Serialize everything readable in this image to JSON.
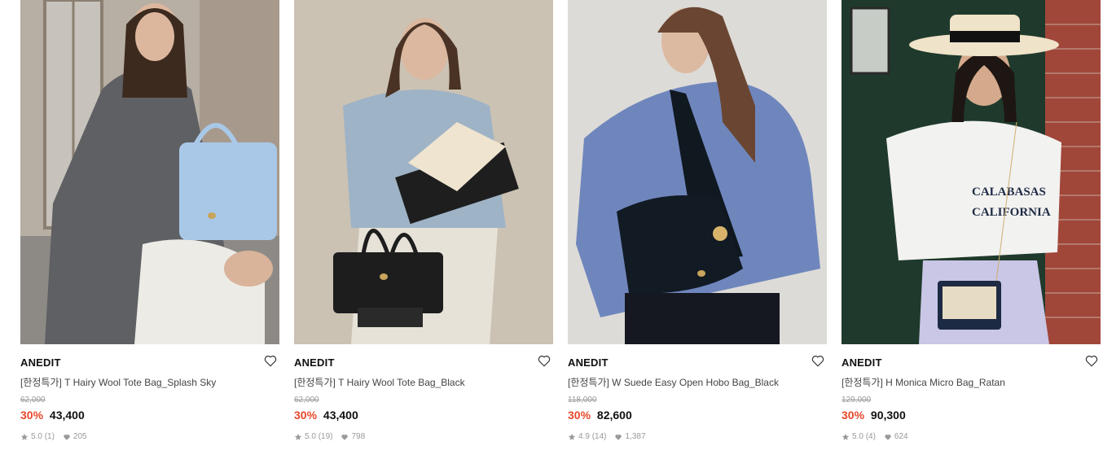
{
  "products": [
    {
      "brand": "ANEDIT",
      "name": "[한정특가] T Hairy Wool Tote Bag_Splash Sky",
      "original_price": "62,000",
      "discount": "30%",
      "sale_price": "43,400",
      "rating": "5.0",
      "reviews": "(1)",
      "likes": "205",
      "colors": {
        "bg": "#b9b1a7",
        "coat": "#5f6063",
        "bag": "#a9c8e8",
        "skirt": "#ecebe6"
      }
    },
    {
      "brand": "ANEDIT",
      "name": "[한정특가] T Hairy Wool Tote Bag_Black",
      "original_price": "62,000",
      "discount": "30%",
      "sale_price": "43,400",
      "rating": "5.0",
      "reviews": "(19)",
      "likes": "798",
      "colors": {
        "bg": "#c9c0b1",
        "top": "#9fb3c6",
        "bag": "#1d1d1d",
        "skirt": "#e7e2d8"
      }
    },
    {
      "brand": "ANEDIT",
      "name": "[한정특가] W Suede Easy Open Hobo Bag_Black",
      "original_price": "118,000",
      "discount": "30%",
      "sale_price": "82,600",
      "rating": "4.9",
      "reviews": "(14)",
      "likes": "1,387",
      "colors": {
        "bg": "#dcdad6",
        "sweater": "#6f86bd",
        "bag": "#121a24",
        "pants": "#151820"
      }
    },
    {
      "brand": "ANEDIT",
      "name": "[한정특가] H Monica Micro Bag_Ratan",
      "original_price": "129,000",
      "discount": "30%",
      "sale_price": "90,300",
      "rating": "5.0",
      "reviews": "(4)",
      "likes": "624",
      "colors": {
        "door": "#1f3a2c",
        "brick": "#a0473a",
        "tee": "#f2f2f0",
        "pants": "#c9c6e6",
        "bag": "#1d2a44"
      }
    }
  ],
  "icons": {
    "like": "heart-outline-icon",
    "rating": "star-icon",
    "likes": "heart-filled-icon"
  },
  "accent": "#e8482b"
}
